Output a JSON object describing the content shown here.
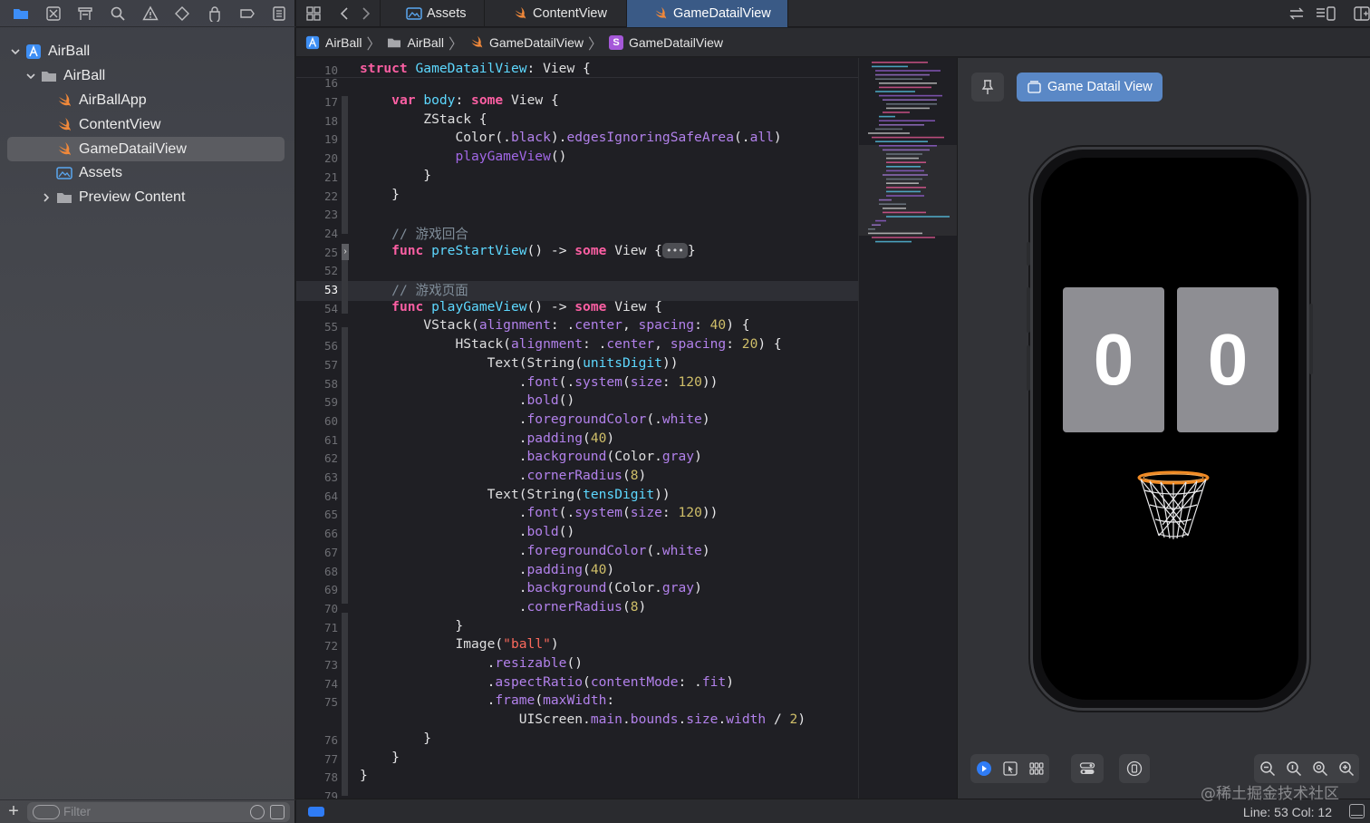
{
  "navigator": {
    "toolbar_icons": [
      "folder-icon",
      "source-control-icon",
      "symbol-icon",
      "search-icon",
      "issue-icon",
      "test-icon",
      "debug-icon",
      "breakpoint-icon",
      "report-icon"
    ],
    "tree": [
      {
        "label": "AirBall",
        "icon": "xcode-project-icon",
        "level": 0,
        "expanded": true
      },
      {
        "label": "AirBall",
        "icon": "folder-icon",
        "level": 1,
        "expanded": true
      },
      {
        "label": "AirBallApp",
        "icon": "swift-file-icon",
        "level": 2
      },
      {
        "label": "ContentView",
        "icon": "swift-file-icon",
        "level": 2
      },
      {
        "label": "GameDatailView",
        "icon": "swift-file-icon",
        "level": 2,
        "selected": true
      },
      {
        "label": "Assets",
        "icon": "asset-catalog-icon",
        "level": 2
      },
      {
        "label": "Preview Content",
        "icon": "folder-icon",
        "level": 2,
        "expanded": false
      }
    ],
    "filter_placeholder": "Filter"
  },
  "tabs": [
    {
      "label": "Assets",
      "icon": "asset-catalog-icon"
    },
    {
      "label": "ContentView",
      "icon": "swift-file-icon"
    },
    {
      "label": "GameDatailView",
      "icon": "swift-file-icon",
      "active": true
    }
  ],
  "breadcrumb": [
    {
      "label": "AirBall",
      "icon": "xcode-project-icon"
    },
    {
      "label": "AirBall",
      "icon": "folder-icon"
    },
    {
      "label": "GameDatailView",
      "icon": "swift-file-icon"
    },
    {
      "label": "GameDatailView",
      "icon": "struct-icon",
      "icon_letter": "S"
    }
  ],
  "editor": {
    "current_line": 53,
    "lines": [
      {
        "n": "10",
        "sticky": true,
        "html": "<span class='kw'>struct</span> <span class='ty'>GameDatailView</span>: <span class='tx'>View</span> {"
      },
      {
        "n": "16",
        "html": ""
      },
      {
        "n": "17",
        "html": "    <span class='kw'>var</span> <span class='ty'>body</span>: <span class='kw'>some</span> <span class='tx'>View</span> {"
      },
      {
        "n": "18",
        "html": "        <span class='tx'>ZStack</span> {"
      },
      {
        "n": "19",
        "html": "            <span class='tx'>Color</span>(.<span class='pr'>black</span>).<span class='pr'>edgesIgnoringSafeArea</span>(.<span class='pr'>all</span>)"
      },
      {
        "n": "20",
        "html": "            <span class='fn'>playGameView</span>()"
      },
      {
        "n": "21",
        "html": "        }"
      },
      {
        "n": "22",
        "html": "    }"
      },
      {
        "n": "23",
        "html": ""
      },
      {
        "n": "24",
        "html": "    <span class='cm'>// 游戏回合</span>"
      },
      {
        "n": "25",
        "html": "    <span class='kw'>func</span> <span class='ty'>preStartView</span>() -> <span class='kw'>some</span> <span class='tx'>View</span> {<span class='ellipsis'>•••</span>}"
      },
      {
        "n": "52",
        "html": ""
      },
      {
        "n": "53",
        "html": "    <span class='cm'>// 游戏页面</span>"
      },
      {
        "n": "54",
        "html": "    <span class='kw'>func</span> <span class='ty'>playGameView</span>() -> <span class='kw'>some</span> <span class='tx'>View</span> {"
      },
      {
        "n": "55",
        "html": "        <span class='tx'>VStack</span>(<span class='pr'>alignment</span>: .<span class='pr'>center</span>, <span class='pr'>spacing</span>: <span class='num'>40</span>) {"
      },
      {
        "n": "56",
        "html": "            <span class='tx'>HStack</span>(<span class='pr'>alignment</span>: .<span class='pr'>center</span>, <span class='pr'>spacing</span>: <span class='num'>20</span>) {"
      },
      {
        "n": "57",
        "html": "                <span class='tx'>Text</span>(<span class='tx'>String</span>(<span class='ty'>unitsDigit</span>))"
      },
      {
        "n": "58",
        "html": "                    .<span class='pr'>font</span>(.<span class='pr'>system</span>(<span class='pr'>size</span>: <span class='num'>120</span>))"
      },
      {
        "n": "59",
        "html": "                    .<span class='pr'>bold</span>()"
      },
      {
        "n": "60",
        "html": "                    .<span class='pr'>foregroundColor</span>(.<span class='pr'>white</span>)"
      },
      {
        "n": "61",
        "html": "                    .<span class='pr'>padding</span>(<span class='num'>40</span>)"
      },
      {
        "n": "62",
        "html": "                    .<span class='pr'>background</span>(<span class='tx'>Color</span>.<span class='pr'>gray</span>)"
      },
      {
        "n": "63",
        "html": "                    .<span class='pr'>cornerRadius</span>(<span class='num'>8</span>)"
      },
      {
        "n": "64",
        "html": "                <span class='tx'>Text</span>(<span class='tx'>String</span>(<span class='ty'>tensDigit</span>))"
      },
      {
        "n": "65",
        "html": "                    .<span class='pr'>font</span>(.<span class='pr'>system</span>(<span class='pr'>size</span>: <span class='num'>120</span>))"
      },
      {
        "n": "66",
        "html": "                    .<span class='pr'>bold</span>()"
      },
      {
        "n": "67",
        "html": "                    .<span class='pr'>foregroundColor</span>(.<span class='pr'>white</span>)"
      },
      {
        "n": "68",
        "html": "                    .<span class='pr'>padding</span>(<span class='num'>40</span>)"
      },
      {
        "n": "69",
        "html": "                    .<span class='pr'>background</span>(<span class='tx'>Color</span>.<span class='pr'>gray</span>)"
      },
      {
        "n": "70",
        "html": "                    .<span class='pr'>cornerRadius</span>(<span class='num'>8</span>)"
      },
      {
        "n": "71",
        "html": "            }"
      },
      {
        "n": "72",
        "html": "            <span class='tx'>Image</span>(<span class='str'>\"ball\"</span>)"
      },
      {
        "n": "73",
        "html": "                .<span class='pr'>resizable</span>()"
      },
      {
        "n": "74",
        "html": "                .<span class='pr'>aspectRatio</span>(<span class='pr'>contentMode</span>: .<span class='pr'>fit</span>)"
      },
      {
        "n": "75",
        "html": "                .<span class='pr'>frame</span>(<span class='pr'>maxWidth</span>:"
      },
      {
        "n": "",
        "html": "                    <span class='tx'>UIScreen</span>.<span class='pr'>main</span>.<span class='pr'>bounds</span>.<span class='pr'>size</span>.<span class='pr'>width</span> / <span class='num'>2</span>)"
      },
      {
        "n": "76",
        "html": "        }"
      },
      {
        "n": "77",
        "html": "    }"
      },
      {
        "n": "78",
        "html": "}"
      },
      {
        "n": "79",
        "html": ""
      }
    ]
  },
  "canvas": {
    "preview_name": "Game Datail View",
    "pin_icon": "pin-icon",
    "digits": [
      "0",
      "0"
    ],
    "ball_icon": "basketball-hoop-icon",
    "bottom_controls": [
      "live-preview-icon",
      "selectable-icon",
      "variants-icon",
      "device-settings-icon",
      "orientation-icon"
    ],
    "zoom_controls": [
      "zoom-out-icon",
      "zoom-100-icon",
      "zoom-fit-icon",
      "zoom-in-icon"
    ]
  },
  "status": {
    "position": "Line: 53  Col: 12"
  },
  "watermark": "@稀土掘金技术社区",
  "colors": {
    "accent": "#2f7cf6",
    "active_tab": "#3a5a86",
    "preview_chip": "#5a88c6",
    "keyword": "#fc5fa3",
    "type": "#5dd8ff",
    "number": "#d0bf69",
    "string": "#fc6a5d",
    "comment": "#7f8c98"
  }
}
